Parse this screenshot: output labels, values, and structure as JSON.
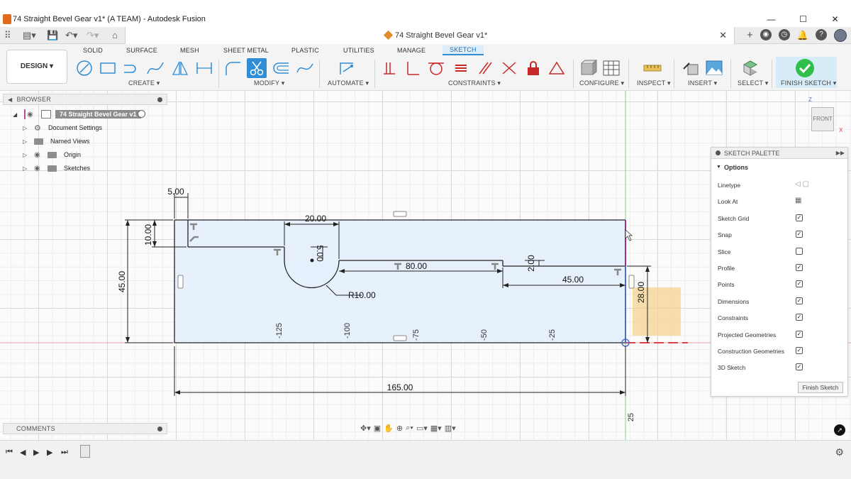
{
  "window": {
    "title": "74 Straight Bevel Gear v1* (A TEAM) - Autodesk Fusion",
    "controls": [
      "—",
      "☐",
      "✕"
    ]
  },
  "document_tab": {
    "name": "74 Straight Bevel Gear v1*"
  },
  "workspace": {
    "label": "DESIGN ▾"
  },
  "ribbon_tabs": [
    {
      "label": "SOLID",
      "active": false
    },
    {
      "label": "SURFACE",
      "active": false
    },
    {
      "label": "MESH",
      "active": false
    },
    {
      "label": "SHEET METAL",
      "active": false
    },
    {
      "label": "PLASTIC",
      "active": false
    },
    {
      "label": "UTILITIES",
      "active": false
    },
    {
      "label": "MANAGE",
      "active": false
    },
    {
      "label": "SKETCH",
      "active": true
    }
  ],
  "ribbon_groups": {
    "create": "CREATE ▾",
    "modify": "MODIFY ▾",
    "automate": "AUTOMATE ▾",
    "constraints": "CONSTRAINTS ▾",
    "configure": "CONFIGURE ▾",
    "inspect": "INSPECT ▾",
    "insert": "INSERT ▾",
    "select": "SELECT ▾",
    "finish": "FINISH SKETCH ▾"
  },
  "browser": {
    "title": "BROWSER",
    "root": "74 Straight Bevel Gear v1",
    "items": [
      {
        "label": "Document Settings",
        "icon": "gear-icon"
      },
      {
        "label": "Named Views",
        "icon": "folder-icon"
      },
      {
        "label": "Origin",
        "icon": "folder-icon"
      },
      {
        "label": "Sketches",
        "icon": "folder-icon"
      }
    ]
  },
  "comments": {
    "title": "COMMENTS"
  },
  "sketch_palette": {
    "title": "SKETCH PALETTE",
    "section": "Options",
    "rows": [
      {
        "label": "Linetype",
        "kind": "icons"
      },
      {
        "label": "Look At",
        "kind": "icon"
      },
      {
        "label": "Sketch Grid",
        "checked": true
      },
      {
        "label": "Snap",
        "checked": true
      },
      {
        "label": "Slice",
        "checked": false
      },
      {
        "label": "Profile",
        "checked": true
      },
      {
        "label": "Points",
        "checked": true
      },
      {
        "label": "Dimensions",
        "checked": true
      },
      {
        "label": "Constraints",
        "checked": true
      },
      {
        "label": "Projected Geometries",
        "checked": true
      },
      {
        "label": "Construction Geometries",
        "checked": true
      },
      {
        "label": "3D Sketch",
        "checked": true
      }
    ],
    "finish_button": "Finish Sketch"
  },
  "viewcube": {
    "face": "FRONT",
    "axis_z": "Z",
    "axis_x": "X"
  },
  "sketch": {
    "dimensions": {
      "overall_width": "165.00",
      "overall_height": "45.00",
      "left_step_width": "5.00",
      "left_step_height": "10.00",
      "slot_width": "20.00",
      "slot_depth": "5.00",
      "arc_radius": "R10.00",
      "middle_length": "80.00",
      "right_step": "2.00",
      "right_length": "45.00",
      "right_height": "28.00"
    },
    "ruler_ticks": [
      "-125",
      "-100",
      "-75",
      "-50",
      "-25"
    ],
    "vertical_tick": "25"
  },
  "colors": {
    "accent": "#2f8dd6",
    "finish_green": "#2fbf4a",
    "profile_fill": "#e4f0fb",
    "axis_green": "#7fd08a",
    "axis_red": "#d9434b",
    "highlight_purple": "#a0307a"
  }
}
